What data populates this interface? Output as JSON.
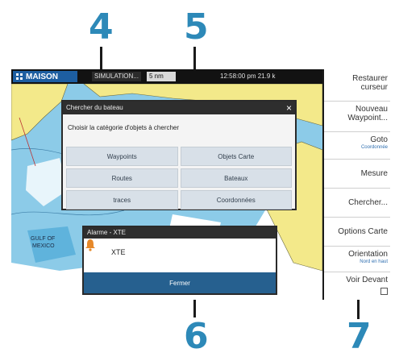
{
  "callouts": {
    "c4": "4",
    "c5": "5",
    "c6": "6",
    "c7": "7"
  },
  "status_bar": {
    "home_label": "MAISON",
    "simulation": "SIMULATION...",
    "speed": "5 nm",
    "time": "12:58:00 pm   21.9 k"
  },
  "search_dialog": {
    "title": "Chercher du bateau",
    "close_icon": "×",
    "prompt": "Choisir la catégorie d'objets à chercher",
    "buttons": [
      "Waypoints",
      "Objets Carte",
      "Routes",
      "Bateaux",
      "traces",
      "Coordonnées"
    ]
  },
  "alarm_dialog": {
    "title": "Alarme - XTE",
    "message": "XTE",
    "close_label": "Fermer",
    "icon": "warning-bell-icon"
  },
  "map": {
    "gulf_label": "GULF OF MEXICO"
  },
  "side_menu": {
    "items": [
      {
        "label": "Restaurer curseur",
        "sub": ""
      },
      {
        "label": "Nouveau Waypoint...",
        "sub": ""
      },
      {
        "label": "Goto",
        "sub": "Coordonnée"
      },
      {
        "label": "Mesure",
        "sub": ""
      },
      {
        "label": "Chercher...",
        "sub": ""
      },
      {
        "label": "Options Carte",
        "sub": ""
      },
      {
        "label": "Orientation",
        "sub": "Nord en haut"
      },
      {
        "label": "Voir Devant",
        "sub": ""
      }
    ]
  },
  "colors": {
    "callout": "#2d89b8",
    "land": "#f3e98a",
    "water": "#7ec4e6",
    "deep_water": "#ffffff",
    "accent": "#26608f"
  }
}
